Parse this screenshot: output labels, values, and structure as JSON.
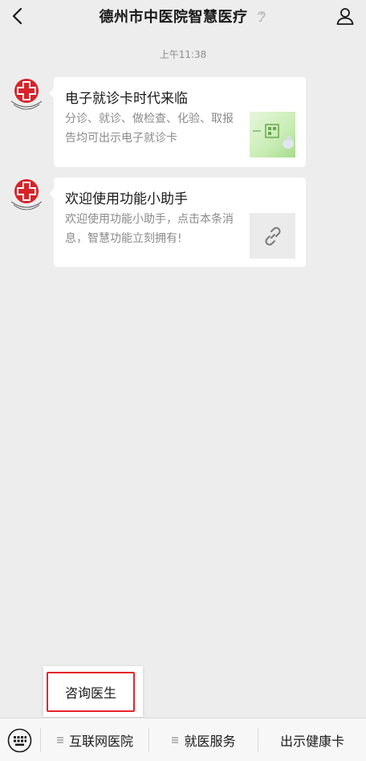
{
  "header": {
    "title": "德州市中医院智慧医疗"
  },
  "chat": {
    "timestamp": "上午11:38",
    "messages": [
      {
        "title": "电子就诊卡时代来临",
        "desc": "分诊、就诊、做检查、化验、取报告均可出示电子就诊卡"
      },
      {
        "title": "欢迎使用功能小助手",
        "desc": "欢迎使用功能小助手，点击本条消息，智慧功能立刻拥有!"
      }
    ]
  },
  "popup": {
    "item": "咨询医生"
  },
  "menu": {
    "items": [
      {
        "label": "互联网医院"
      },
      {
        "label": "就医服务"
      },
      {
        "label": "出示健康卡"
      }
    ]
  },
  "colors": {
    "background": "#ededed",
    "highlight": "#e5242a",
    "logo_red": "#d8232a"
  }
}
